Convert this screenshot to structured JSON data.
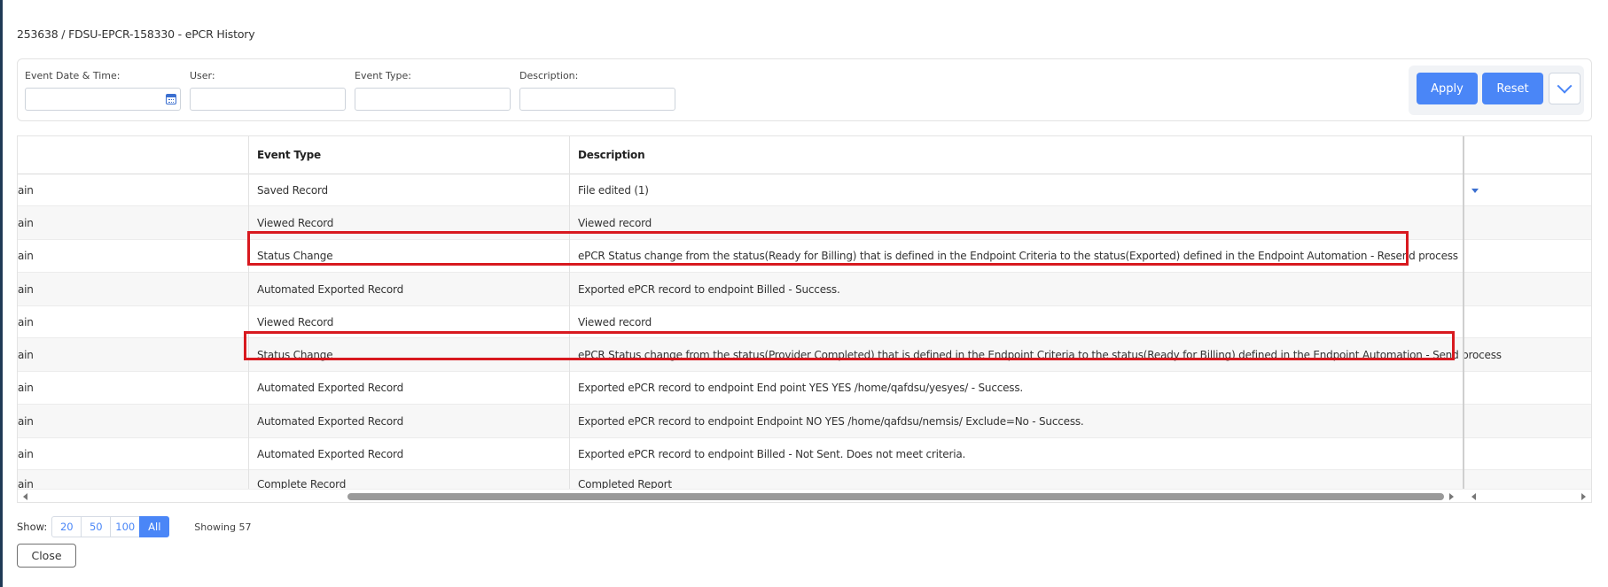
{
  "page_title": "253638 / FDSU-EPCR-158330 - ePCR History",
  "filters": {
    "event_date_label": "Event Date & Time:",
    "user_label": "User:",
    "event_type_label": "Event Type:",
    "description_label": "Description:",
    "event_date_value": "",
    "user_value": "",
    "event_type_value": "",
    "description_value": ""
  },
  "buttons": {
    "apply": "Apply",
    "reset": "Reset",
    "close": "Close"
  },
  "table": {
    "headers": [
      "",
      "Event Type",
      "Description"
    ],
    "rows": [
      [
        "ain",
        "Saved Record",
        "File edited (1)"
      ],
      [
        "ain",
        "Viewed Record",
        "Viewed record"
      ],
      [
        "ain",
        "Status Change",
        "ePCR Status change from the status(Ready for Billing) that is defined in the Endpoint Criteria to the status(Exported) defined in the Endpoint Automation - Resend process"
      ],
      [
        "ain",
        "Automated Exported Record",
        "Exported ePCR record to endpoint Billed - Success."
      ],
      [
        "ain",
        "Viewed Record",
        "Viewed record"
      ],
      [
        "ain",
        "Status Change",
        "ePCR Status change from the status(Provider Completed) that is defined in the Endpoint Criteria to the status(Ready for Billing) defined in the Endpoint Automation - Send process"
      ],
      [
        "ain",
        "Automated Exported Record",
        "Exported ePCR record to endpoint End point YES YES /home/qafdsu/yesyes/ - Success."
      ],
      [
        "ain",
        "Automated Exported Record",
        "Exported ePCR record to endpoint Endpoint NO YES /home/qafdsu/nemsis/ Exclude=No - Success."
      ],
      [
        "ain",
        "Automated Exported Record",
        "Exported ePCR record to endpoint Billed - Not Sent. Does not meet criteria."
      ],
      [
        "ain",
        "Complete Record",
        "Completed Report"
      ]
    ]
  },
  "pagination": {
    "label": "Show:",
    "options": [
      "20",
      "50",
      "100",
      "All"
    ],
    "active": "All",
    "showing": "Showing 57"
  },
  "colors": {
    "accent": "#4a86f7",
    "highlight": "#d8191f"
  },
  "icons": [
    "calendar-icon",
    "chevron-down-icon",
    "dropdown-caret-icon",
    "scroll-left-icon",
    "scroll-right-icon"
  ]
}
